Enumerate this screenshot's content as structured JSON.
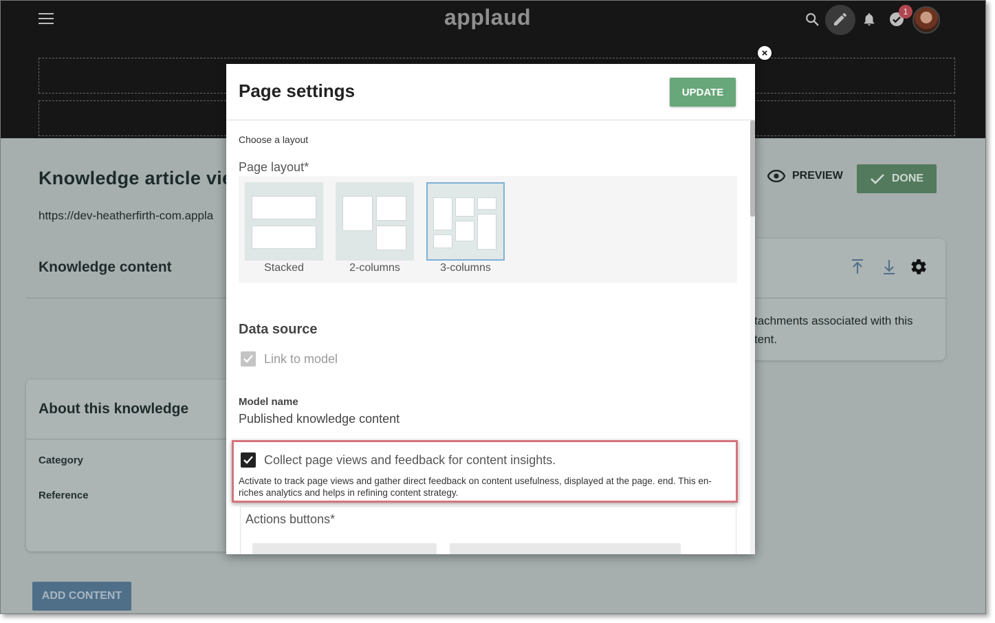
{
  "header": {
    "logo": "applaud",
    "menu_icon": "hamburger-menu-icon",
    "icons": [
      "search-icon",
      "pencil-icon",
      "bell-icon",
      "check-circle-icon",
      "avatar"
    ],
    "notification_count": "1"
  },
  "page": {
    "title": "Knowledge article vie",
    "url": "https://dev-heatherfirth-com.appla",
    "preview_label": "PREVIEW",
    "done_label": "DONE",
    "knowledge_content_heading": "Knowledge content",
    "right_card_text_line1": "tachments associated with this",
    "right_card_text_line2": "tent.",
    "about_heading": "About this knowledge",
    "category_label": "Category",
    "reference_label": "Reference",
    "add_content_label": "ADD CONTENT"
  },
  "modal": {
    "title": "Page settings",
    "update_label": "UPDATE",
    "close_label": "×",
    "choose_layout": "Choose a layout",
    "page_layout_label": "Page layout*",
    "layouts": [
      {
        "label": "Stacked",
        "selected": false
      },
      {
        "label": "2-columns",
        "selected": false
      },
      {
        "label": "3-columns",
        "selected": true
      }
    ],
    "data_source_heading": "Data source",
    "link_to_model_label": "Link to model",
    "link_to_model_checked": true,
    "model_name_label": "Model name",
    "model_name_value": "Published knowledge content",
    "collect_label": "Collect page views and feedback for content insights.",
    "collect_checked": true,
    "collect_description": "Activate to track page views and gather direct feedback on content usefulness, displayed at the page. end. This en-riches analytics and helps in refining content strategy.",
    "actions_buttons_label": "Actions buttons*"
  },
  "colors": {
    "header_bg": "#161616",
    "overlay_bg": "#a6aeae",
    "update_button": "#67a779",
    "highlight_border": "#d5747c",
    "selected_layout_border": "#7eb0d6"
  }
}
